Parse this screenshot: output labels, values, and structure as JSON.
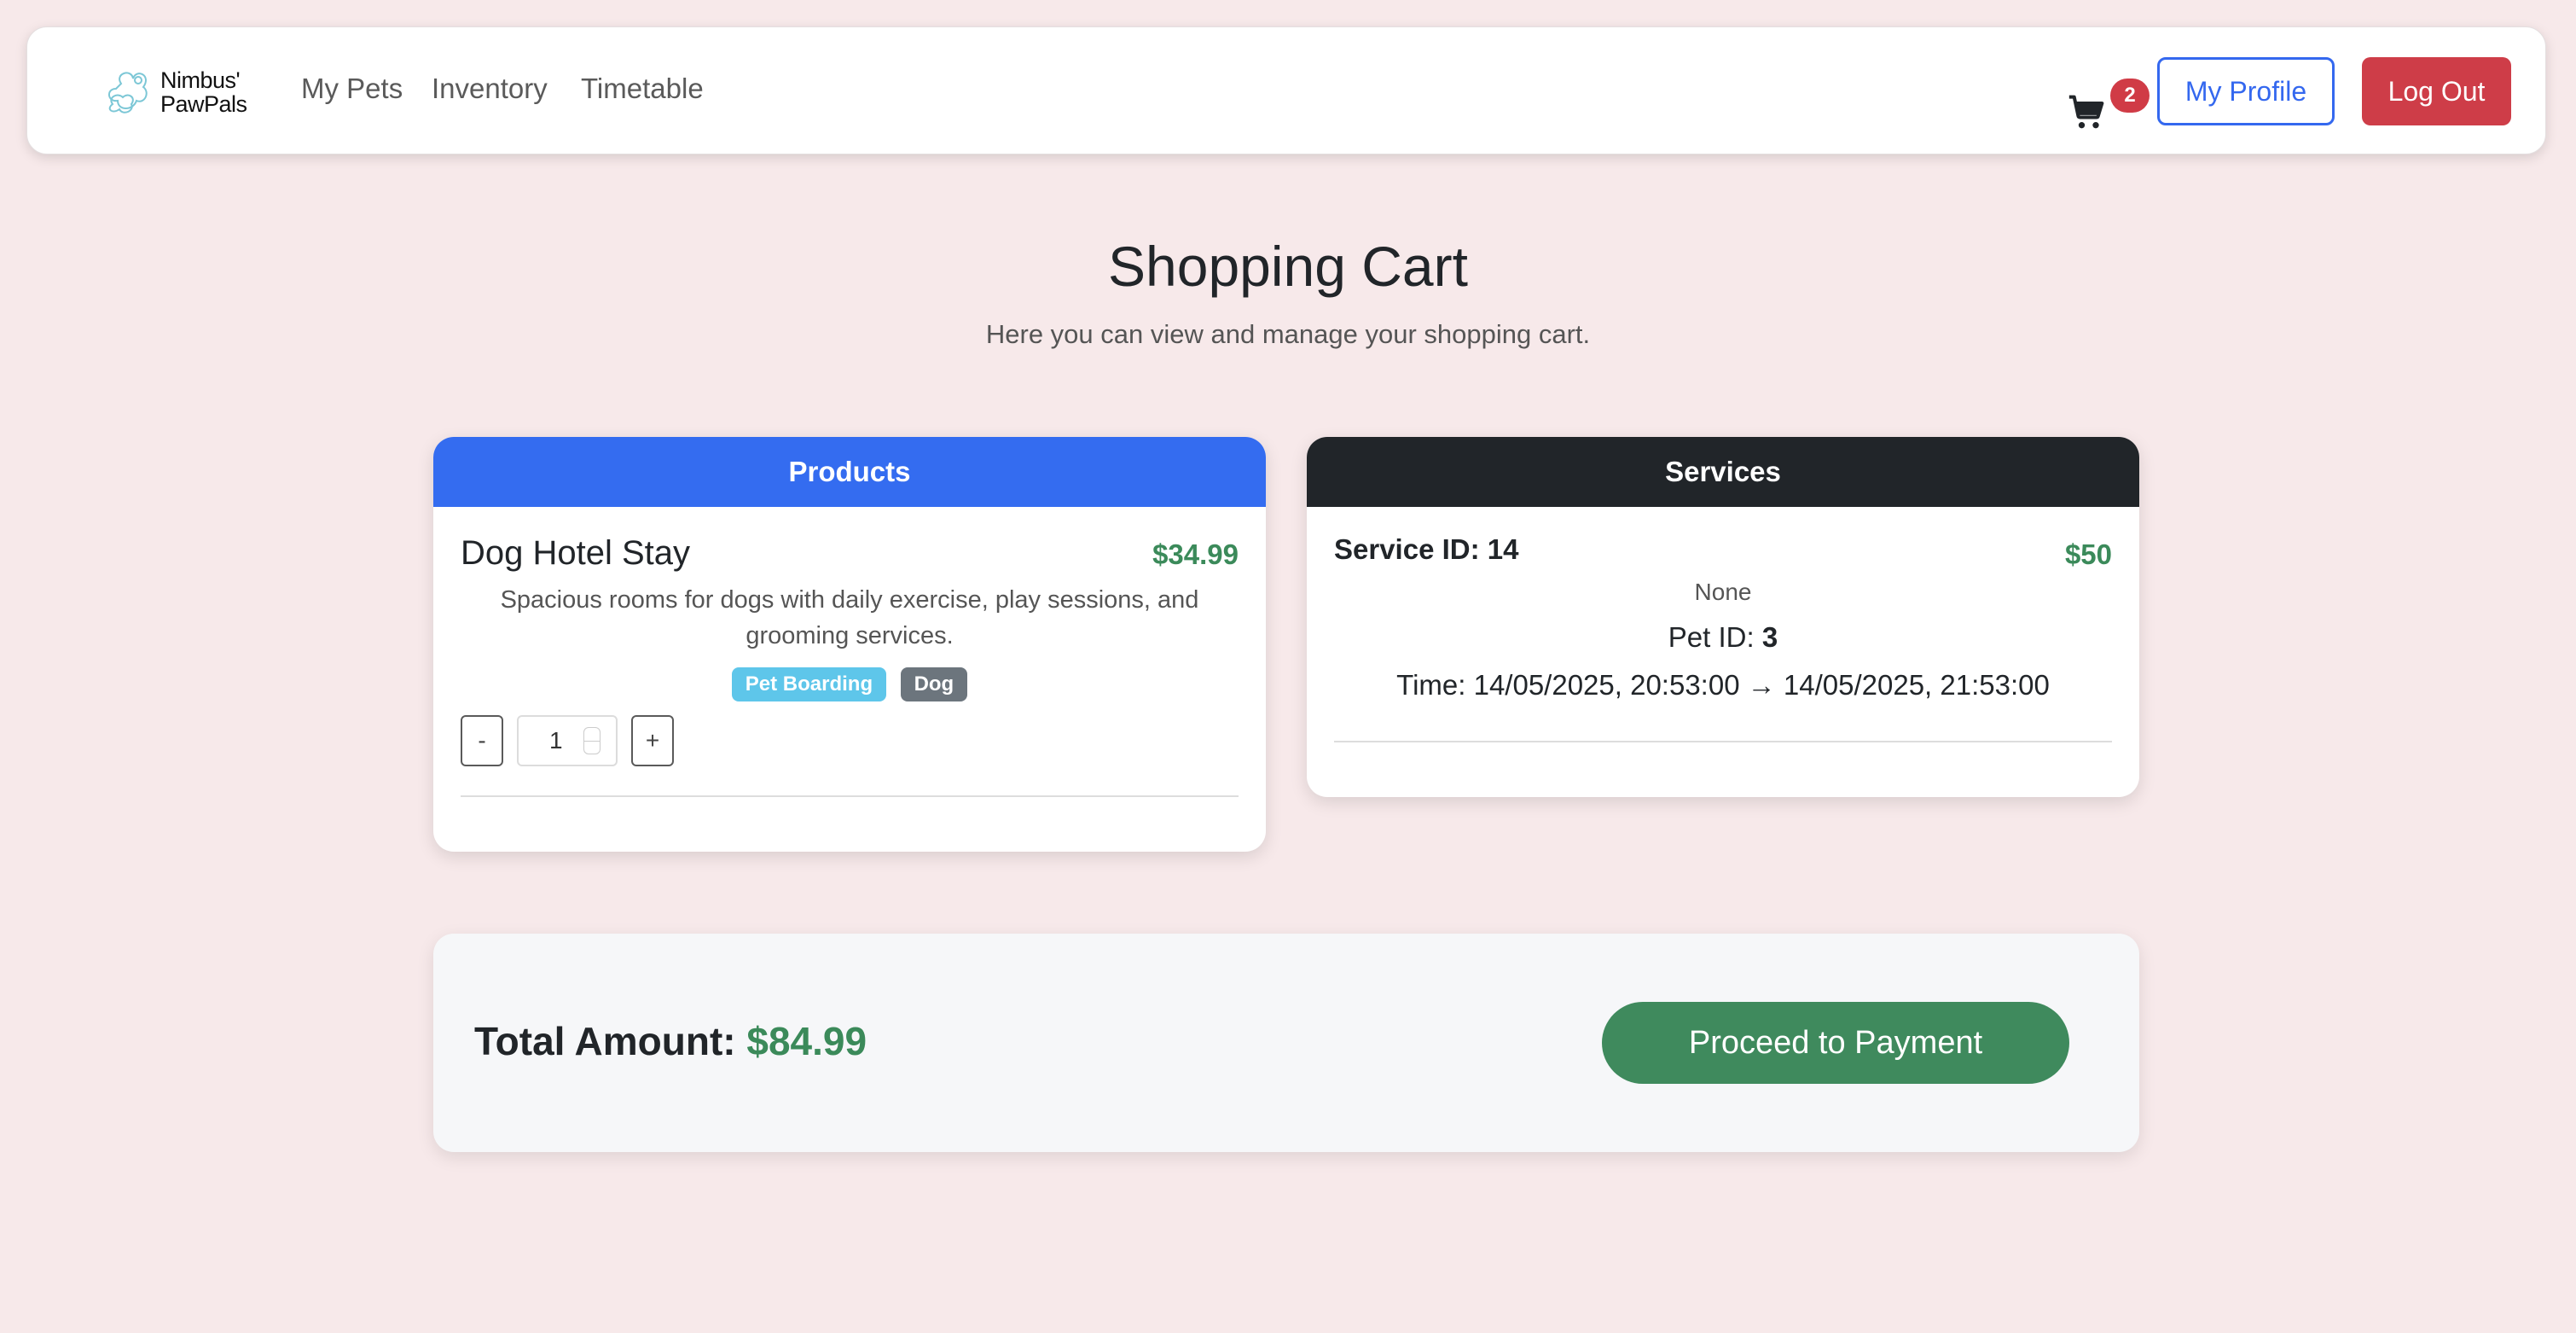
{
  "brand": {
    "name_line1": "Nimbus'",
    "name_line2": "PawPals"
  },
  "nav": {
    "links": [
      "My Pets",
      "Inventory",
      "Timetable"
    ],
    "cart_count": "2",
    "profile_label": "My Profile",
    "logout_label": "Log Out"
  },
  "page": {
    "title": "Shopping Cart",
    "subtitle": "Here you can view and manage your shopping cart."
  },
  "products": {
    "header": "Products",
    "items": [
      {
        "name": "Dog Hotel Stay",
        "price": "$34.99",
        "description": "Spacious rooms for dogs with daily exercise, play sessions, and grooming services.",
        "tags": [
          "Pet Boarding",
          "Dog"
        ],
        "quantity": "1",
        "minus_label": "-",
        "plus_label": "+"
      }
    ]
  },
  "services": {
    "header": "Services",
    "items": [
      {
        "id_label": "Service ID: 14",
        "price": "$50",
        "description": "None",
        "pet_label": "Pet ID: ",
        "pet_id": "3",
        "time": "Time: 14/05/2025, 20:53:00 → 14/05/2025, 21:53:00"
      }
    ]
  },
  "total": {
    "label": "Total Amount: ",
    "amount": "$84.99",
    "pay_label": "Proceed to Payment"
  },
  "colors": {
    "background": "#f7e9ea",
    "primary": "#346cf0",
    "danger": "#ce3d48",
    "success": "#3f8a5d",
    "dark": "#212529",
    "info": "#5ec6ea",
    "secondary": "#6c757d"
  }
}
